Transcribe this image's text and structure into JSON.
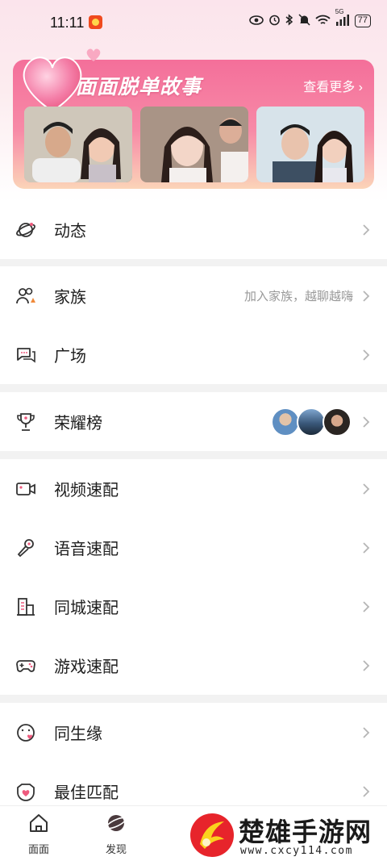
{
  "status_bar": {
    "time": "11:11",
    "battery": "77",
    "signal_label": "5G"
  },
  "banner": {
    "title": "面面脱单故事",
    "more_label": "查看更多 ›",
    "photos": [
      {
        "name": "couple-photo-1"
      },
      {
        "name": "couple-photo-2"
      },
      {
        "name": "couple-photo-3"
      }
    ]
  },
  "menu": {
    "dynamic": {
      "label": "动态",
      "icon": "planet-icon"
    },
    "family": {
      "label": "家族",
      "hint": "加入家族，越聊越嗨",
      "icon": "family-icon"
    },
    "square": {
      "label": "广场",
      "icon": "chat-bubbles-icon"
    },
    "ranking": {
      "label": "荣耀榜",
      "icon": "trophy-icon"
    },
    "video_match": {
      "label": "视频速配",
      "icon": "video-camera-icon"
    },
    "voice_match": {
      "label": "语音速配",
      "icon": "microphone-icon"
    },
    "city_match": {
      "label": "同城速配",
      "icon": "building-icon"
    },
    "game_match": {
      "label": "游戏速配",
      "icon": "gamepad-icon"
    },
    "same_birth": {
      "label": "同生缘",
      "icon": "birthday-icon"
    },
    "best_match": {
      "label": "最佳匹配",
      "icon": "heart-match-icon"
    }
  },
  "bottom_nav": {
    "items": [
      {
        "label": "面面",
        "icon": "home-icon"
      },
      {
        "label": "发现",
        "icon": "planet-icon"
      }
    ]
  },
  "watermark": {
    "text": "楚雄手游网",
    "url": "www.cxcy114.com"
  },
  "colors": {
    "banner_top": "#f46f9a",
    "banner_bottom": "#fbd4b8",
    "accent": "#ee5a7e"
  }
}
